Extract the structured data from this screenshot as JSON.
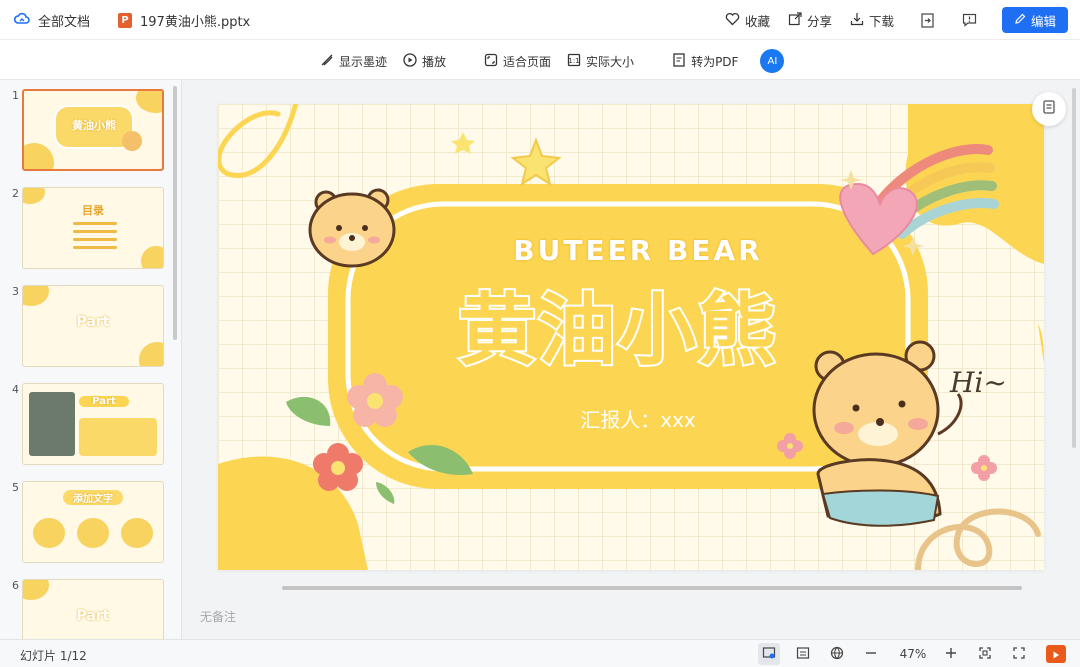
{
  "header": {
    "all_docs": "全部文档",
    "file_badge": "P",
    "file_name": "197黄油小熊.pptx",
    "favorite": "收藏",
    "share": "分享",
    "download": "下载",
    "edit": "编辑"
  },
  "toolbar": {
    "show_ink": "显示墨迹",
    "play": "播放",
    "fit_page": "适合页面",
    "actual_size": "实际大小",
    "to_pdf": "转为PDF",
    "ai_label": "AI"
  },
  "thumbnails": [
    {
      "num": "1",
      "title": "黄油小熊"
    },
    {
      "num": "2",
      "title": "目录"
    },
    {
      "num": "3",
      "title": "Part"
    },
    {
      "num": "4",
      "title": "Part"
    },
    {
      "num": "5",
      "title": "添加文字"
    },
    {
      "num": "6",
      "title": "Part"
    }
  ],
  "slide": {
    "subtitle": "BUTEER BEAR",
    "title": "黄油小熊",
    "reporter": "汇报人：xxx",
    "hi": "Hi~"
  },
  "notes_placeholder": "无备注",
  "status": {
    "slide_count": "幻灯片 1/12",
    "zoom": "47%"
  },
  "colors": {
    "accent": "#1f6ff5",
    "slide_yellow": "#fcd653",
    "active_thumb_border": "#e8793f",
    "play_orange": "#ea5a1b"
  }
}
